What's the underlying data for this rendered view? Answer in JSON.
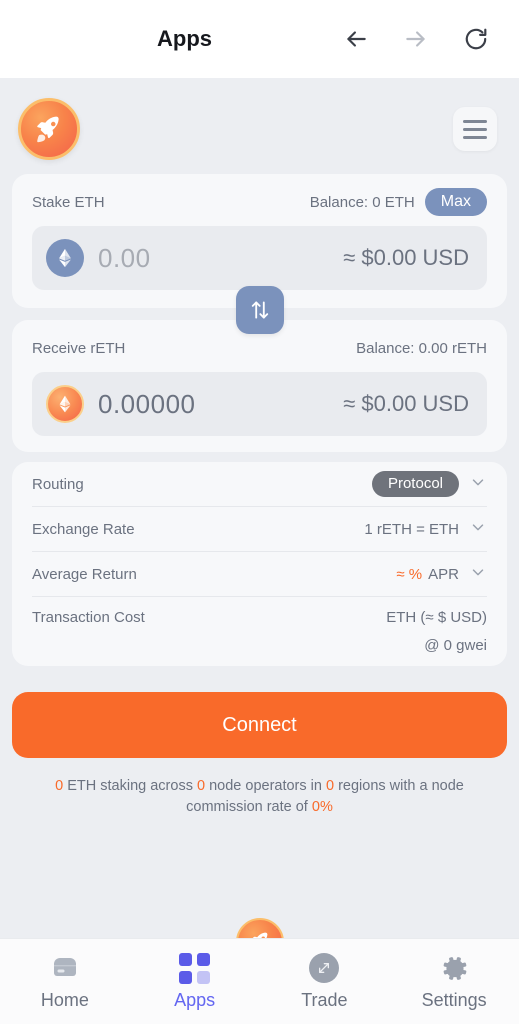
{
  "chrome": {
    "title": "Apps",
    "back_icon": "arrow-left-icon",
    "forward_icon": "arrow-right-icon",
    "reload_icon": "reload-icon"
  },
  "app_header": {
    "logo_icon": "rocket-pool-logo",
    "menu_icon": "hamburger-menu-icon"
  },
  "stake": {
    "label": "Stake ETH",
    "balance": "Balance: 0 ETH",
    "max_label": "Max",
    "coin_icon": "ethereum-icon",
    "amount_placeholder": "0.00",
    "amount_value": "0.00",
    "usd": "≈ $0.00 USD"
  },
  "swap": {
    "icon": "swap-vertical-icon"
  },
  "receive": {
    "label": "Receive rETH",
    "balance": "Balance: 0.00 rETH",
    "coin_icon": "reth-icon",
    "amount_value": "0.00000",
    "usd": "≈ $0.00 USD"
  },
  "details": {
    "rows": [
      {
        "key": "Routing",
        "value": "Protocol",
        "value_type": "pill",
        "chevron": true
      },
      {
        "key": "Exchange Rate",
        "value": "1 rETH = ETH",
        "value_type": "text",
        "chevron": true
      },
      {
        "key": "Average Return",
        "value_prefix": "≈ %",
        "value": "APR",
        "value_type": "accent",
        "chevron": true
      },
      {
        "key": "Transaction Cost",
        "value": "ETH (≈ $ USD)",
        "value_type": "text",
        "chevron": false
      }
    ],
    "gwei": "@ 0 gwei"
  },
  "connect": {
    "label": "Connect"
  },
  "stats": {
    "eth_amount": "0",
    "part1": " ETH staking across ",
    "operators": "0",
    "part2": " node operators in ",
    "regions": "0",
    "part3": " regions with a node commission rate of ",
    "commission": "0%"
  },
  "float_rocket": {
    "icon": "rocket-pool-logo"
  },
  "tabbar": {
    "items": [
      {
        "label": "Home",
        "icon": "home-icon",
        "active": false
      },
      {
        "label": "Apps",
        "icon": "apps-grid-icon",
        "active": true
      },
      {
        "label": "Trade",
        "icon": "trade-expand-icon",
        "active": false
      },
      {
        "label": "Settings",
        "icon": "gear-icon",
        "active": false
      }
    ]
  },
  "colors": {
    "accent_orange": "#f96a2a",
    "steel_blue": "#7b92bc",
    "active_indigo": "#6366f1",
    "page_bg": "#eceef2",
    "card_bg": "#f7f8fa"
  }
}
